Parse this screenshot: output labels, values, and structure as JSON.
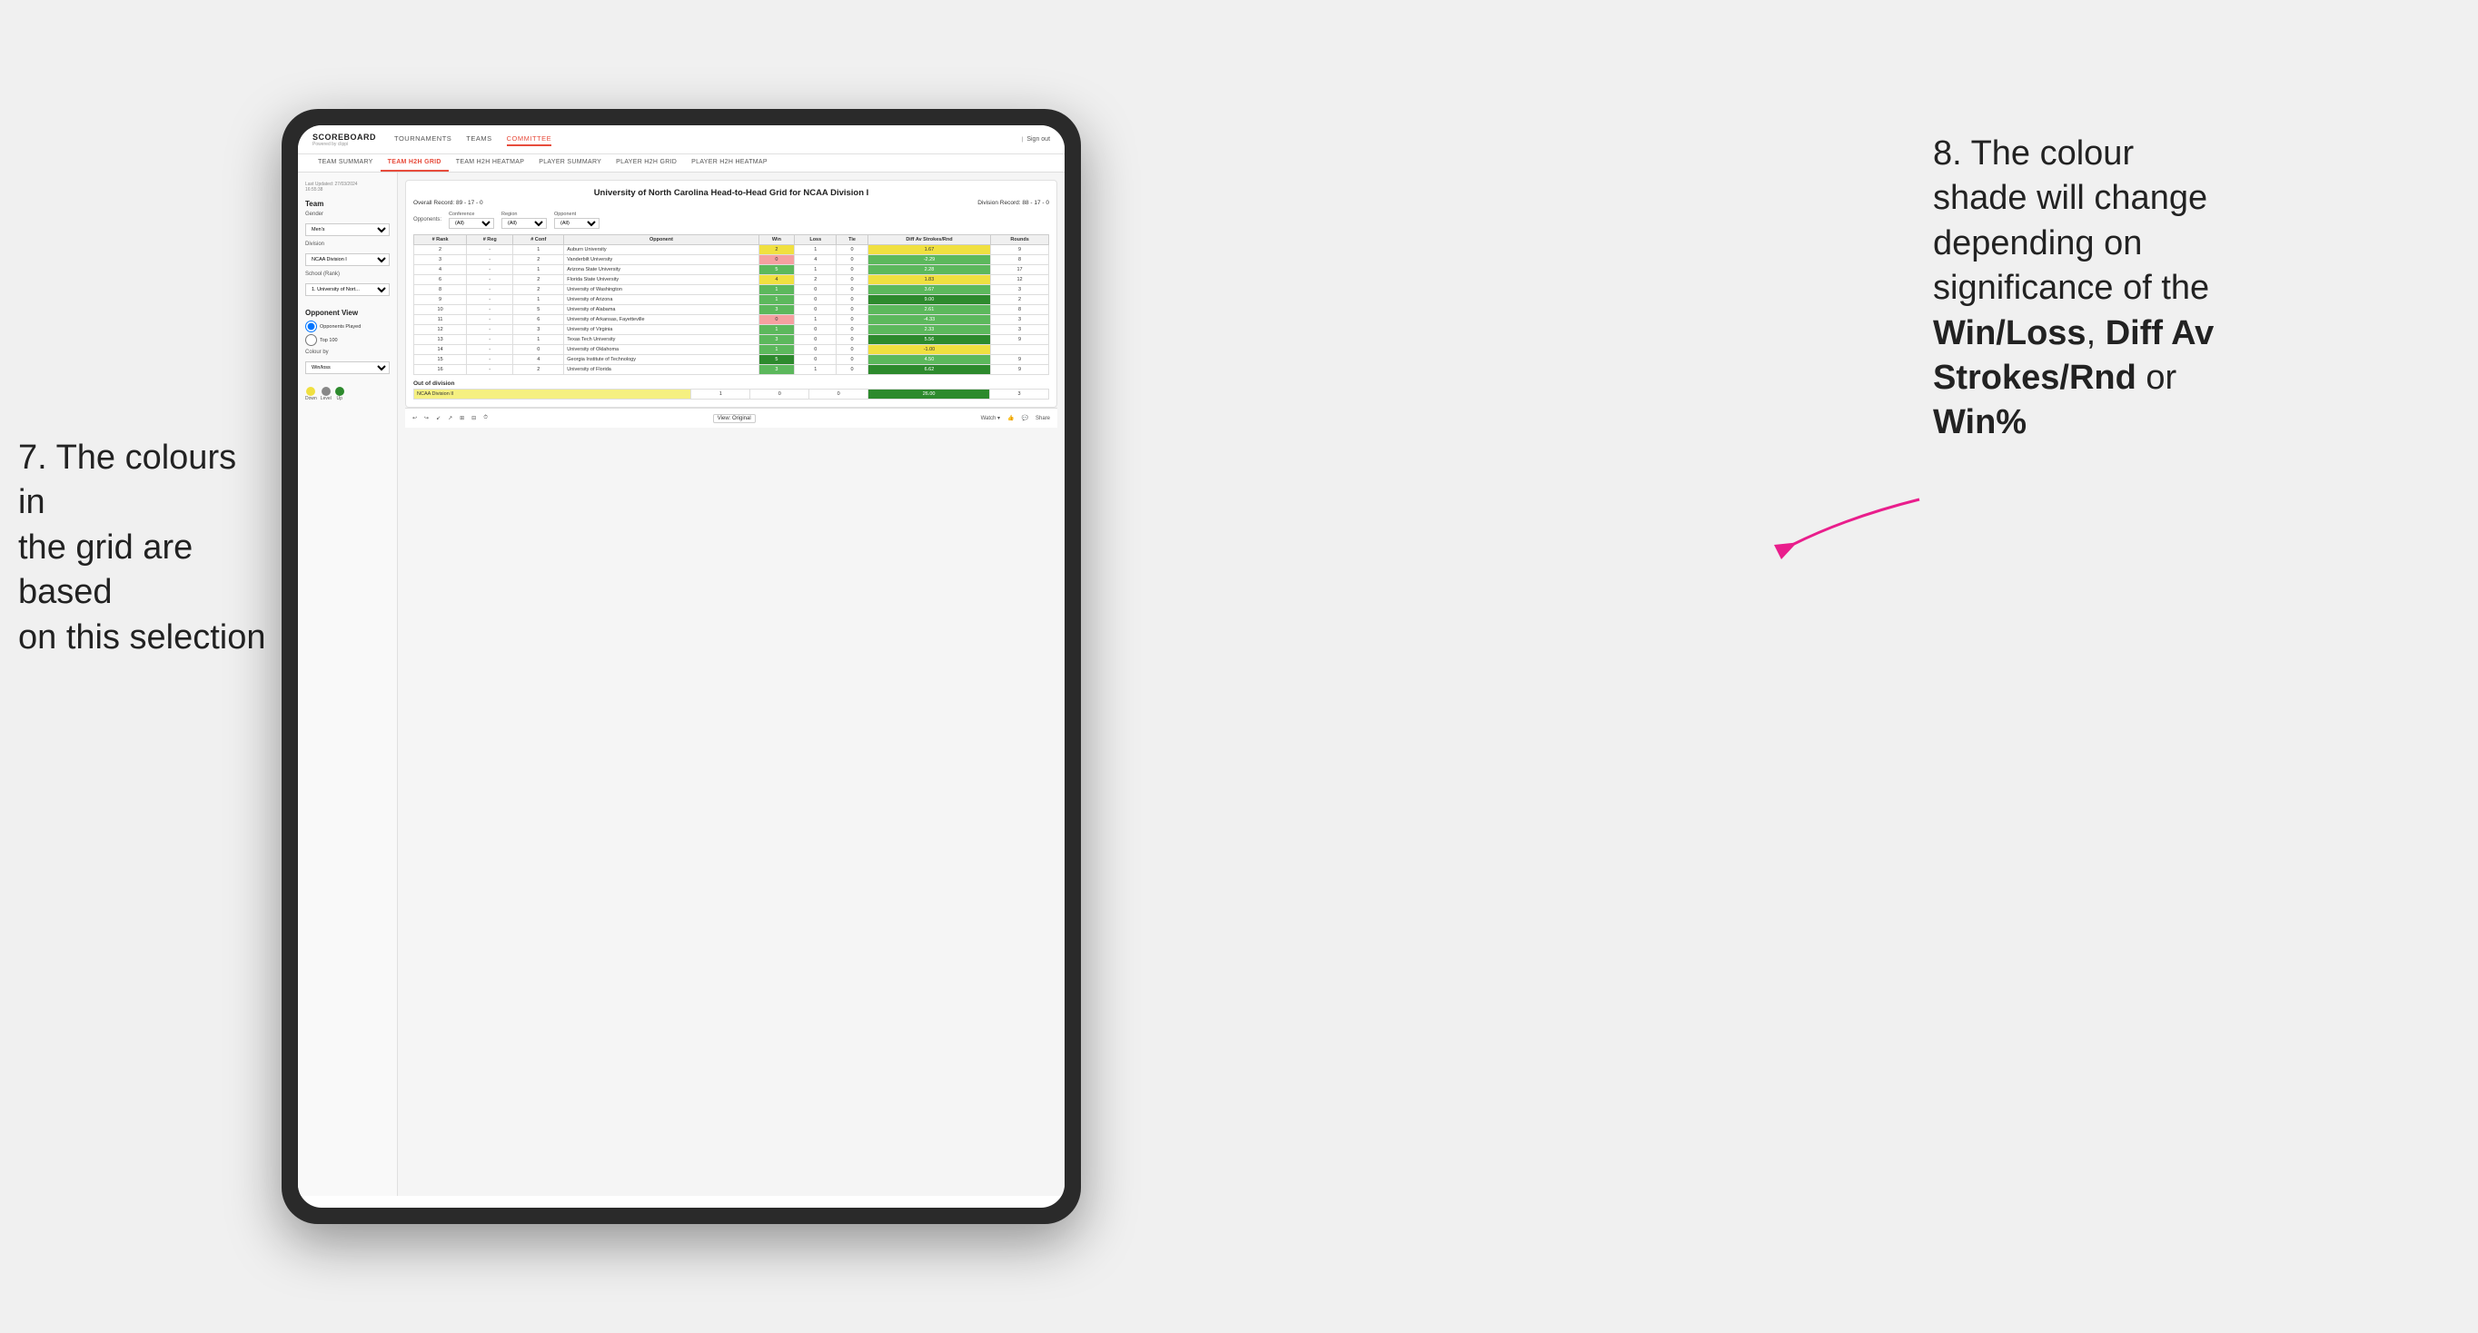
{
  "app": {
    "logo": "SCOREBOARD",
    "logo_sub": "Powered by clippi",
    "sign_out": "Sign out"
  },
  "main_nav": {
    "items": [
      {
        "label": "TOURNAMENTS",
        "active": false
      },
      {
        "label": "TEAMS",
        "active": false
      },
      {
        "label": "COMMITTEE",
        "active": true
      }
    ]
  },
  "sub_nav": {
    "items": [
      {
        "label": "TEAM SUMMARY",
        "active": false
      },
      {
        "label": "TEAM H2H GRID",
        "active": true
      },
      {
        "label": "TEAM H2H HEATMAP",
        "active": false
      },
      {
        "label": "PLAYER SUMMARY",
        "active": false
      },
      {
        "label": "PLAYER H2H GRID",
        "active": false
      },
      {
        "label": "PLAYER H2H HEATMAP",
        "active": false
      }
    ]
  },
  "left_panel": {
    "updated_label": "Last Updated: 27/03/2024",
    "updated_time": "16:55:38",
    "team_section": "Team",
    "gender_label": "Gender",
    "gender_value": "Men's",
    "division_label": "Division",
    "division_value": "NCAA Division I",
    "school_label": "School (Rank)",
    "school_value": "1. University of Nort...",
    "opponent_view_label": "Opponent View",
    "radio1": "Opponents Played",
    "radio2": "Top 100",
    "colour_by_label": "Colour by",
    "colour_by_value": "Win/loss",
    "legend_down": "Down",
    "legend_level": "Level",
    "legend_up": "Up"
  },
  "grid": {
    "title": "University of North Carolina Head-to-Head Grid for NCAA Division I",
    "overall_record_label": "Overall Record:",
    "overall_record": "89 - 17 - 0",
    "division_record_label": "Division Record:",
    "division_record": "88 - 17 - 0",
    "filters": {
      "opponents_label": "Opponents:",
      "conference_label": "Conference",
      "conference_value": "(All)",
      "region_label": "Region",
      "region_value": "(All)",
      "opponent_label": "Opponent",
      "opponent_value": "(All)"
    },
    "columns": [
      "# Rank",
      "# Reg",
      "# Conf",
      "Opponent",
      "Win",
      "Loss",
      "Tie",
      "Diff Av Strokes/Rnd",
      "Rounds"
    ],
    "rows": [
      {
        "rank": "2",
        "reg": "-",
        "conf": "1",
        "opponent": "Auburn University",
        "win": "2",
        "loss": "1",
        "tie": "0",
        "diff": "1.67",
        "rounds": "9",
        "win_color": "yellow",
        "diff_color": "yellow"
      },
      {
        "rank": "3",
        "reg": "-",
        "conf": "2",
        "opponent": "Vanderbilt University",
        "win": "0",
        "loss": "4",
        "tie": "0",
        "diff": "-2.29",
        "rounds": "8",
        "win_color": "red",
        "diff_color": "green"
      },
      {
        "rank": "4",
        "reg": "-",
        "conf": "1",
        "opponent": "Arizona State University",
        "win": "5",
        "loss": "1",
        "tie": "0",
        "diff": "2.28",
        "rounds": "17",
        "win_color": "green",
        "diff_color": "green"
      },
      {
        "rank": "6",
        "reg": "-",
        "conf": "2",
        "opponent": "Florida State University",
        "win": "4",
        "loss": "2",
        "tie": "0",
        "diff": "1.83",
        "rounds": "12",
        "win_color": "yellow",
        "diff_color": "yellow"
      },
      {
        "rank": "8",
        "reg": "-",
        "conf": "2",
        "opponent": "University of Washington",
        "win": "1",
        "loss": "0",
        "tie": "0",
        "diff": "3.67",
        "rounds": "3",
        "win_color": "green",
        "diff_color": "green"
      },
      {
        "rank": "9",
        "reg": "-",
        "conf": "1",
        "opponent": "University of Arizona",
        "win": "1",
        "loss": "0",
        "tie": "0",
        "diff": "9.00",
        "rounds": "2",
        "win_color": "green",
        "diff_color": "green-dark"
      },
      {
        "rank": "10",
        "reg": "-",
        "conf": "5",
        "opponent": "University of Alabama",
        "win": "3",
        "loss": "0",
        "tie": "0",
        "diff": "2.61",
        "rounds": "8",
        "win_color": "green",
        "diff_color": "green"
      },
      {
        "rank": "11",
        "reg": "-",
        "conf": "6",
        "opponent": "University of Arkansas, Fayetteville",
        "win": "0",
        "loss": "1",
        "tie": "0",
        "diff": "-4.33",
        "rounds": "3",
        "win_color": "red",
        "diff_color": "green"
      },
      {
        "rank": "12",
        "reg": "-",
        "conf": "3",
        "opponent": "University of Virginia",
        "win": "1",
        "loss": "0",
        "tie": "0",
        "diff": "2.33",
        "rounds": "3",
        "win_color": "green",
        "diff_color": "green"
      },
      {
        "rank": "13",
        "reg": "-",
        "conf": "1",
        "opponent": "Texas Tech University",
        "win": "3",
        "loss": "0",
        "tie": "0",
        "diff": "5.56",
        "rounds": "9",
        "win_color": "green",
        "diff_color": "green-dark"
      },
      {
        "rank": "14",
        "reg": "-",
        "conf": "0",
        "opponent": "University of Oklahoma",
        "win": "1",
        "loss": "0",
        "tie": "0",
        "diff": "-1.00",
        "rounds": "",
        "win_color": "green",
        "diff_color": "yellow"
      },
      {
        "rank": "15",
        "reg": "-",
        "conf": "4",
        "opponent": "Georgia Institute of Technology",
        "win": "5",
        "loss": "0",
        "tie": "0",
        "diff": "4.50",
        "rounds": "9",
        "win_color": "green-dark",
        "diff_color": "green"
      },
      {
        "rank": "16",
        "reg": "-",
        "conf": "2",
        "opponent": "University of Florida",
        "win": "3",
        "loss": "1",
        "tie": "0",
        "diff": "6.62",
        "rounds": "9",
        "win_color": "green",
        "diff_color": "green-dark"
      }
    ],
    "out_of_division_label": "Out of division",
    "out_of_division_rows": [
      {
        "label": "NCAA Division II",
        "win": "1",
        "loss": "0",
        "tie": "0",
        "diff": "26.00",
        "rounds": "3",
        "diff_color": "green-dark"
      }
    ]
  },
  "bottom_toolbar": {
    "view_label": "View: Original",
    "watch_label": "Watch ▾",
    "share_label": "Share"
  },
  "annotations": {
    "left_annotation": "7. The colours in the grid are based on this selection",
    "right_annotation_line1": "8. The colour shade will change depending on significance of the ",
    "right_bold1": "Win/Loss",
    "right_annotation_line2": ", ",
    "right_bold2": "Diff Av Strokes/Rnd",
    "right_annotation_line3": " or ",
    "right_bold3": "Win%"
  }
}
